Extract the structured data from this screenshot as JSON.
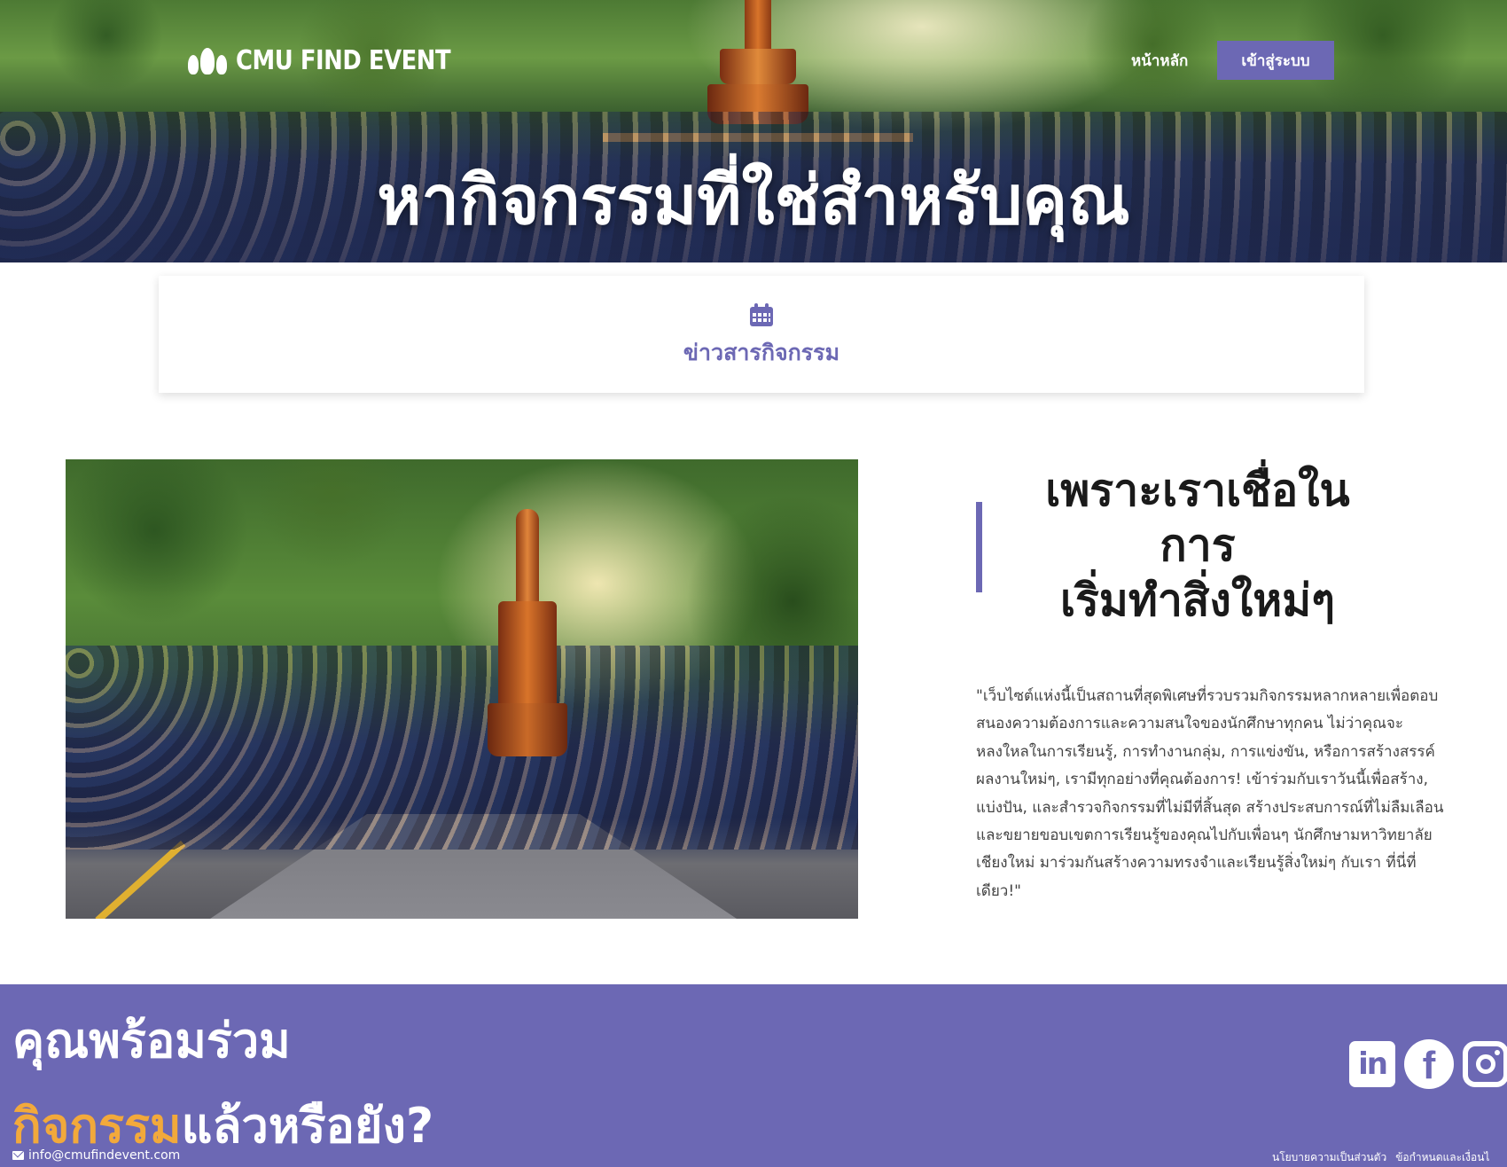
{
  "header": {
    "brand_name": "CMU FIND EVENT",
    "nav_home": "หน้าหลัก",
    "nav_login": "เข้าสู่ระบบ",
    "hero_title": "หากิจกรรมที่ใช่สำหรับคุณ"
  },
  "news_card": {
    "icon": "calendar-icon",
    "label": "ข่าวสารกิจกรรม"
  },
  "about": {
    "heading": "เพราะเราเชื่อใน\nการ\nเริ่มทำสิ่งใหม่ๆ",
    "description": "\"เว็บไซต์แห่งนี้เป็นสถานที่สุดพิเศษที่รวบรวมกิจกรรมหลากหลายเพื่อตอบสนองความต้องการและความสนใจของนักศึกษาทุกคน ไม่ว่าคุณจะหลงใหลในการเรียนรู้, การทำงานกลุ่ม, การแข่งขัน, หรือการสร้างสรรค์ผลงานใหม่ๆ, เรามีทุกอย่างที่คุณต้องการ! เข้าร่วมกับเราวันนี้เพื่อสร้าง, แบ่งปัน, และสำรวจกิจกรรมที่ไม่มีที่สิ้นสุด สร้างประสบการณ์ที่ไม่ลืมเลือนและขยายขอบเขตการเรียนรู้ของคุณไปกับเพื่อนๆ นักศึกษามหาวิทยาลัยเชียงใหม่ มาร่วมกันสร้างความทรงจำและเรียนรู้สิ่งใหม่ๆ กับเรา ที่นี่ที่เดียว!\""
  },
  "footer": {
    "cta_line1": "คุณพร้อมร่วม",
    "cta_accent": "กิจกรรม",
    "cta_rest": "แล้วหรือยัง?",
    "email": "info@cmufindevent.com",
    "social_icons": [
      "linkedin-icon",
      "facebook-icon",
      "instagram-icon"
    ],
    "legal_links": [
      "นโยบายความเป็นส่วนตัว",
      "ข้อกำหนดและเงื่อนไ"
    ]
  },
  "colors": {
    "accent": "#6c68b4",
    "cta_highlight": "#f2a93b"
  }
}
